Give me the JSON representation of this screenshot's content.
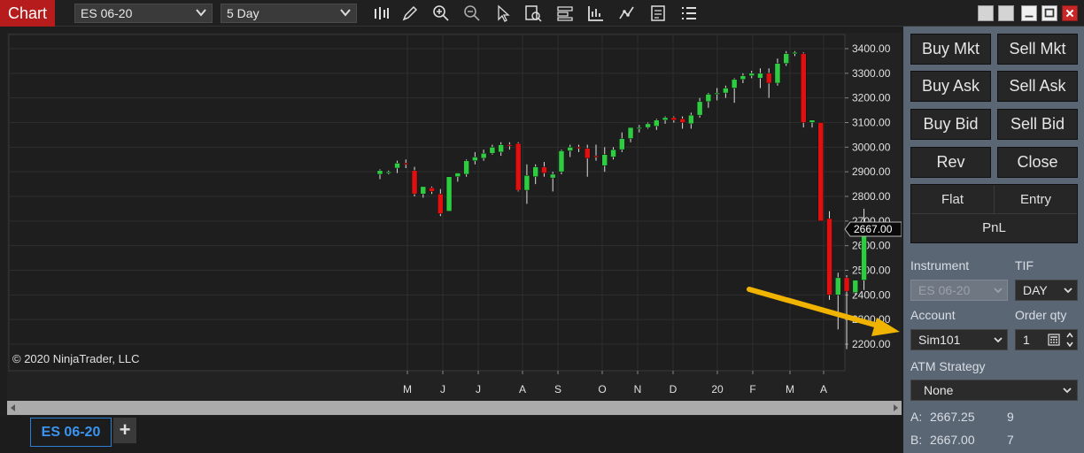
{
  "toolbar": {
    "title": "Chart",
    "instrument": "ES 06-20",
    "period": "5 Day",
    "tools": [
      "bar-type-icon",
      "drawing-tools-icon",
      "zoom-in-icon",
      "zoom-out-icon",
      "pointer-icon",
      "data-box-icon",
      "templates-icon",
      "strategies-icon",
      "indicators-icon",
      "properties-icon",
      "list-icon"
    ]
  },
  "window": {
    "buttons": [
      "restore-icon",
      "restore-icon",
      "minimize-icon",
      "maximize-icon",
      "close-icon"
    ]
  },
  "chart": {
    "copyright": "© 2020 NinjaTrader, LLC",
    "last_price": "2667.00",
    "price_labels": [
      "3400.00",
      "3300.00",
      "3200.00",
      "3100.00",
      "3000.00",
      "2900.00",
      "2800.00",
      "2700.00",
      "2600.00",
      "2500.00",
      "2400.00",
      "2300.00",
      "2200.00"
    ],
    "month_labels": [
      "M",
      "J",
      "J",
      "A",
      "S",
      "O",
      "N",
      "D",
      "20",
      "F",
      "M",
      "A"
    ],
    "colors": {
      "up": "#2ecc40",
      "down": "#e01010",
      "annotation_arrow": "#f0b400"
    }
  },
  "chart_data": {
    "type": "candlestick",
    "ylim": [
      2150,
      3450
    ],
    "x": [
      "M",
      "J",
      "J",
      "A",
      "S",
      "O",
      "N",
      "D",
      "20",
      "F",
      "M",
      "A"
    ],
    "candles": [
      [
        2890,
        2910,
        2870,
        2905
      ],
      [
        2900,
        2905,
        2890,
        2900
      ],
      [
        2915,
        2945,
        2895,
        2935
      ],
      [
        2935,
        2950,
        2915,
        2930
      ],
      [
        2905,
        2920,
        2800,
        2810
      ],
      [
        2810,
        2840,
        2795,
        2840
      ],
      [
        2835,
        2840,
        2810,
        2820
      ],
      [
        2810,
        2830,
        2720,
        2730
      ],
      [
        2740,
        2880,
        2740,
        2880
      ],
      [
        2880,
        2895,
        2860,
        2895
      ],
      [
        2890,
        2950,
        2880,
        2945
      ],
      [
        2945,
        2980,
        2930,
        2960
      ],
      [
        2955,
        2990,
        2945,
        2975
      ],
      [
        2975,
        3010,
        2970,
        3000
      ],
      [
        2980,
        3020,
        2965,
        3010
      ],
      [
        3010,
        3020,
        2990,
        3005
      ],
      [
        3015,
        3020,
        2820,
        2825
      ],
      [
        2825,
        2930,
        2770,
        2885
      ],
      [
        2880,
        2930,
        2850,
        2920
      ],
      [
        2920,
        2940,
        2880,
        2895
      ],
      [
        2875,
        2900,
        2820,
        2890
      ],
      [
        2900,
        2990,
        2890,
        2985
      ],
      [
        2985,
        3010,
        2960,
        3000
      ],
      [
        3000,
        3010,
        2980,
        2995
      ],
      [
        2995,
        3010,
        2880,
        2955
      ],
      [
        2965,
        3010,
        2945,
        2960
      ],
      [
        2925,
        3000,
        2900,
        2970
      ],
      [
        2960,
        3000,
        2950,
        2990
      ],
      [
        2990,
        3060,
        2980,
        3035
      ],
      [
        3035,
        3080,
        3020,
        3080
      ],
      [
        3075,
        3090,
        3060,
        3080
      ],
      [
        3080,
        3100,
        3075,
        3095
      ],
      [
        3085,
        3115,
        3070,
        3110
      ],
      [
        3110,
        3125,
        3095,
        3120
      ],
      [
        3120,
        3125,
        3100,
        3110
      ],
      [
        3115,
        3125,
        3075,
        3100
      ],
      [
        3095,
        3140,
        3075,
        3130
      ],
      [
        3130,
        3200,
        3120,
        3185
      ],
      [
        3185,
        3220,
        3160,
        3215
      ],
      [
        3215,
        3240,
        3190,
        3220
      ],
      [
        3220,
        3250,
        3200,
        3240
      ],
      [
        3240,
        3280,
        3180,
        3275
      ],
      [
        3275,
        3300,
        3260,
        3290
      ],
      [
        3290,
        3310,
        3280,
        3300
      ],
      [
        3280,
        3320,
        3240,
        3300
      ],
      [
        3300,
        3320,
        3200,
        3260
      ],
      [
        3260,
        3360,
        3250,
        3340
      ],
      [
        3340,
        3390,
        3330,
        3380
      ],
      [
        3380,
        3390,
        3370,
        3385
      ],
      [
        3380,
        3385,
        3080,
        3100
      ],
      [
        3100,
        3110,
        3080,
        3110
      ],
      [
        3100,
        3100,
        2840,
        2700
      ],
      [
        2710,
        2740,
        2380,
        2400
      ],
      [
        2400,
        2490,
        2260,
        2470
      ],
      [
        2470,
        2480,
        2180,
        2415
      ],
      [
        2410,
        2450,
        2400,
        2460
      ],
      [
        2460,
        2750,
        2420,
        2660
      ]
    ]
  },
  "panel": {
    "buy_mkt": "Buy Mkt",
    "sell_mkt": "Sell Mkt",
    "buy_ask": "Buy Ask",
    "sell_ask": "Sell Ask",
    "buy_bid": "Buy Bid",
    "sell_bid": "Sell Bid",
    "rev": "Rev",
    "close": "Close",
    "flat": "Flat",
    "entry": "Entry",
    "pnl": "PnL",
    "instrument_label": "Instrument",
    "instrument_value": "ES 06-20",
    "tif_label": "TIF",
    "tif_value": "DAY",
    "account_label": "Account",
    "account_value": "Sim101",
    "qty_label": "Order qty",
    "qty_value": "1",
    "atm_label": "ATM Strategy",
    "atm_value": "None",
    "ask_label": "A:",
    "ask_price": "2667.25",
    "ask_size": "9",
    "bid_label": "B:",
    "bid_price": "2667.00",
    "bid_size": "7"
  },
  "tabs": {
    "active": "ES 06-20",
    "add": "+"
  }
}
